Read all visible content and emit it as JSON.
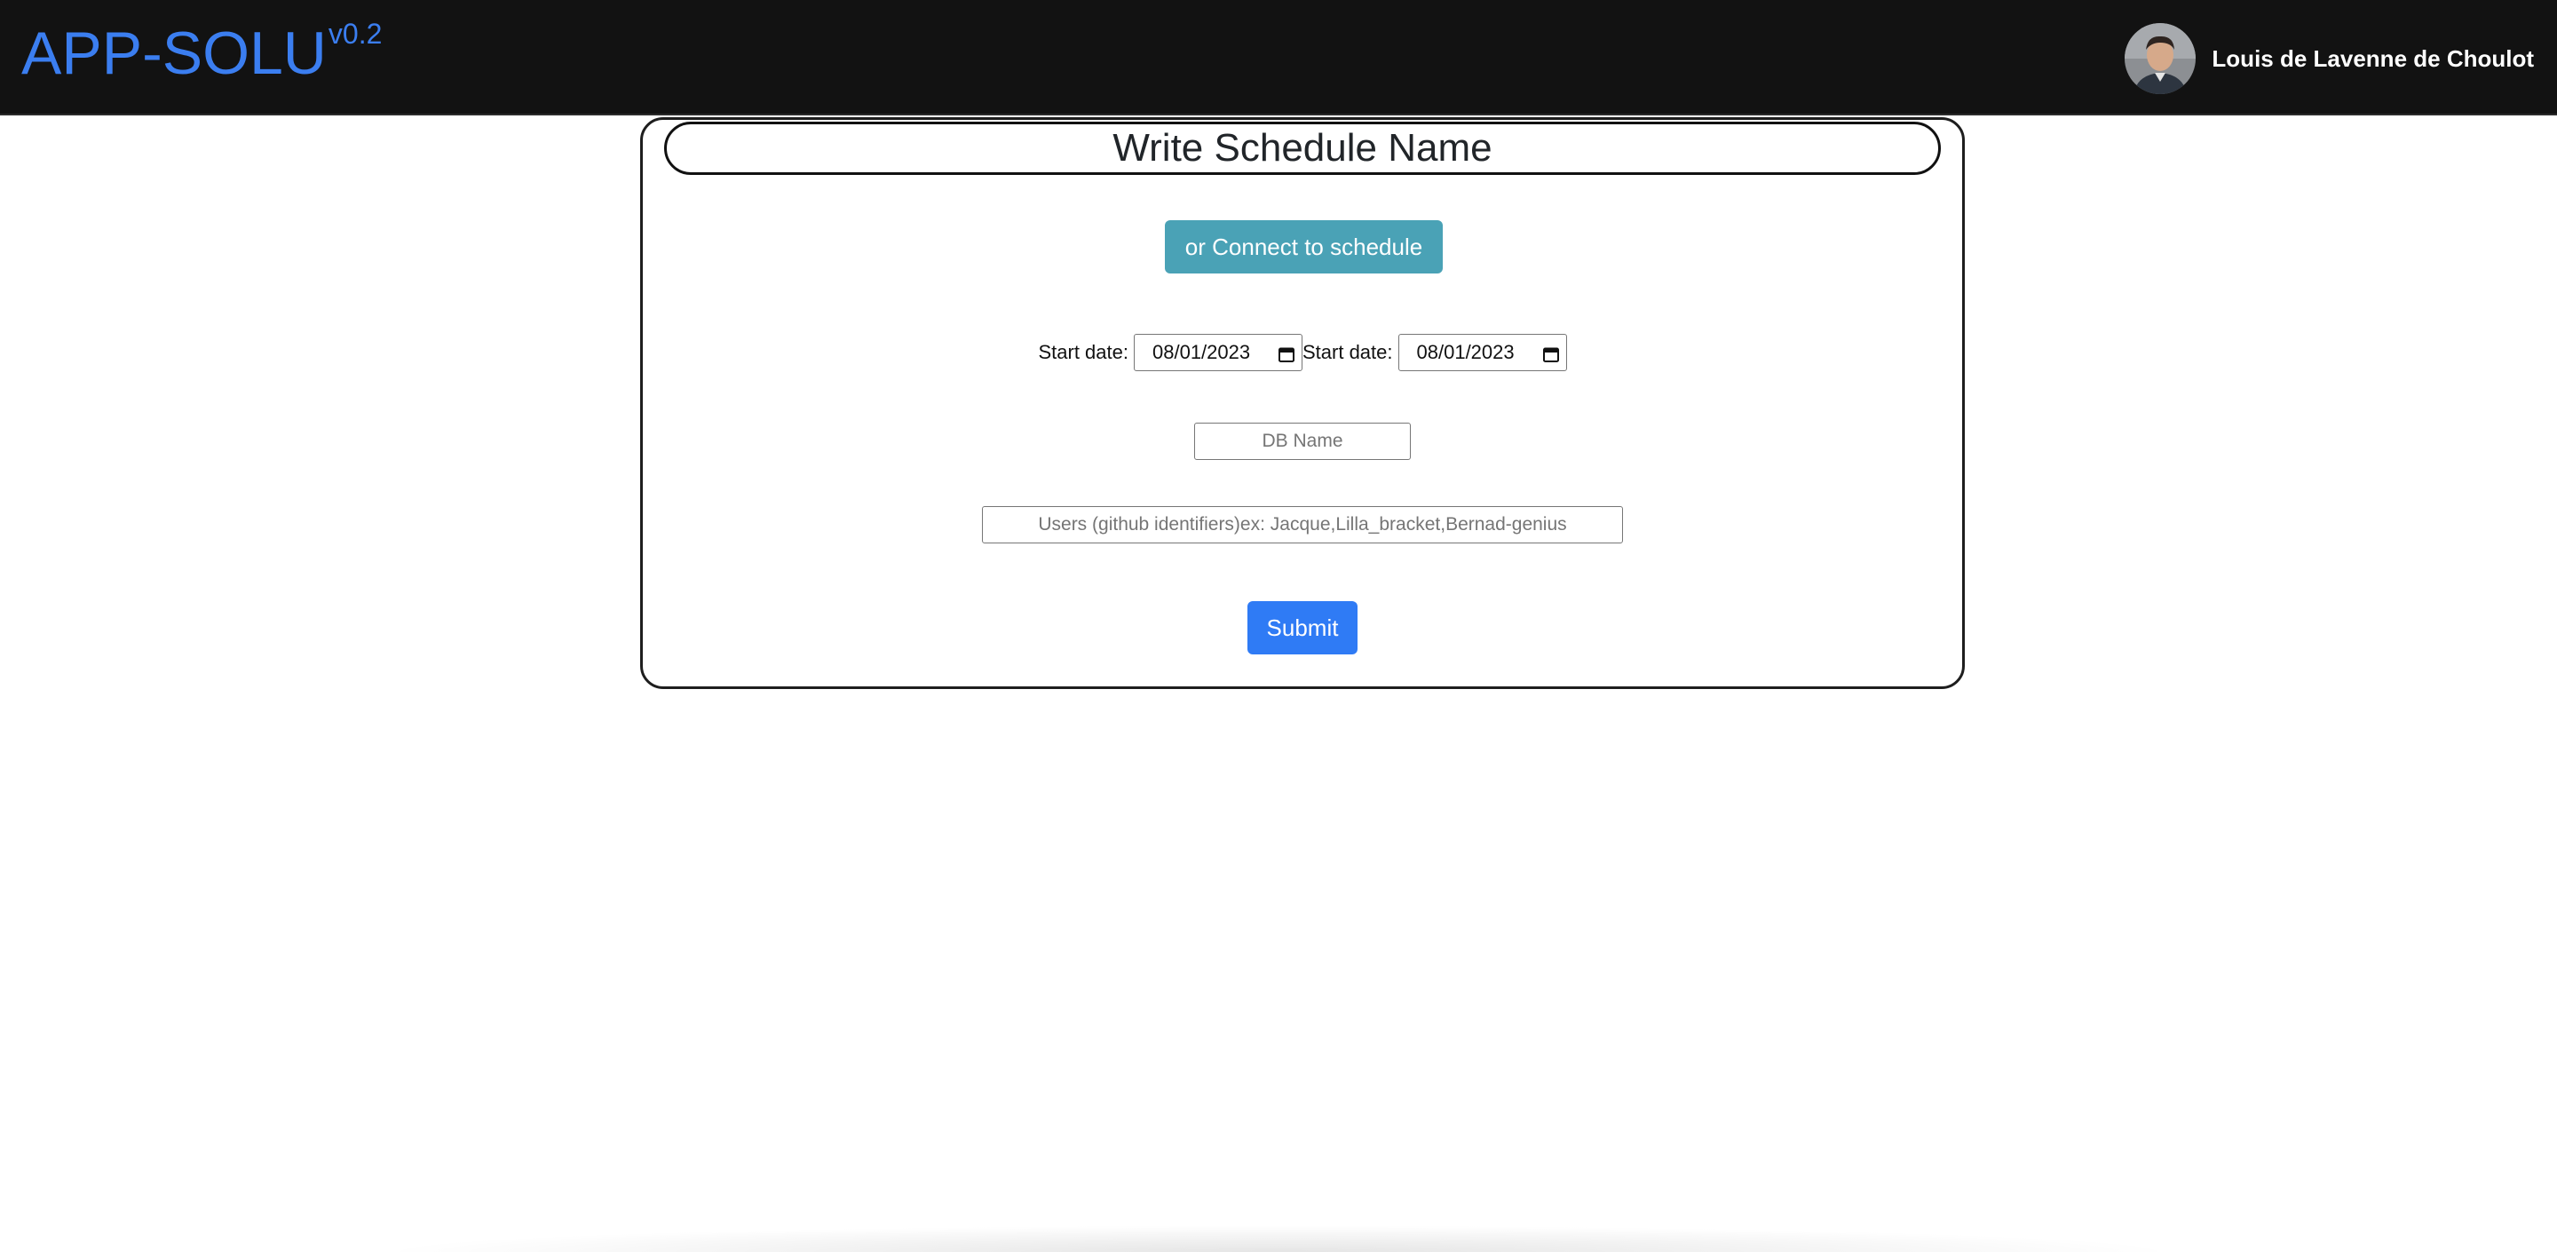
{
  "header": {
    "brand": "APP-SOLU",
    "version": "v0.2",
    "user_name": "Louis de Lavenne de Choulot"
  },
  "form": {
    "schedule_name": "Write Schedule Name",
    "connect_label": "or Connect to schedule",
    "start_date_label_1": "Start date:",
    "start_date_value_1": "08/01/2023",
    "start_date_label_2": "Start date:",
    "start_date_value_2": "08/01/2023",
    "db_name_placeholder": "DB Name",
    "users_placeholder": "Users (github identifiers)ex: Jacque,Lilla_bracket,Bernad-genius",
    "submit_label": "Submit"
  },
  "colors": {
    "navbar_bg": "#121212",
    "brand": "#3b7ef0",
    "connect_button": "#4aa2b6",
    "submit_button": "#2f7bf5"
  },
  "icons": {
    "avatar": "user-avatar",
    "date_picker": "calendar-icon"
  }
}
